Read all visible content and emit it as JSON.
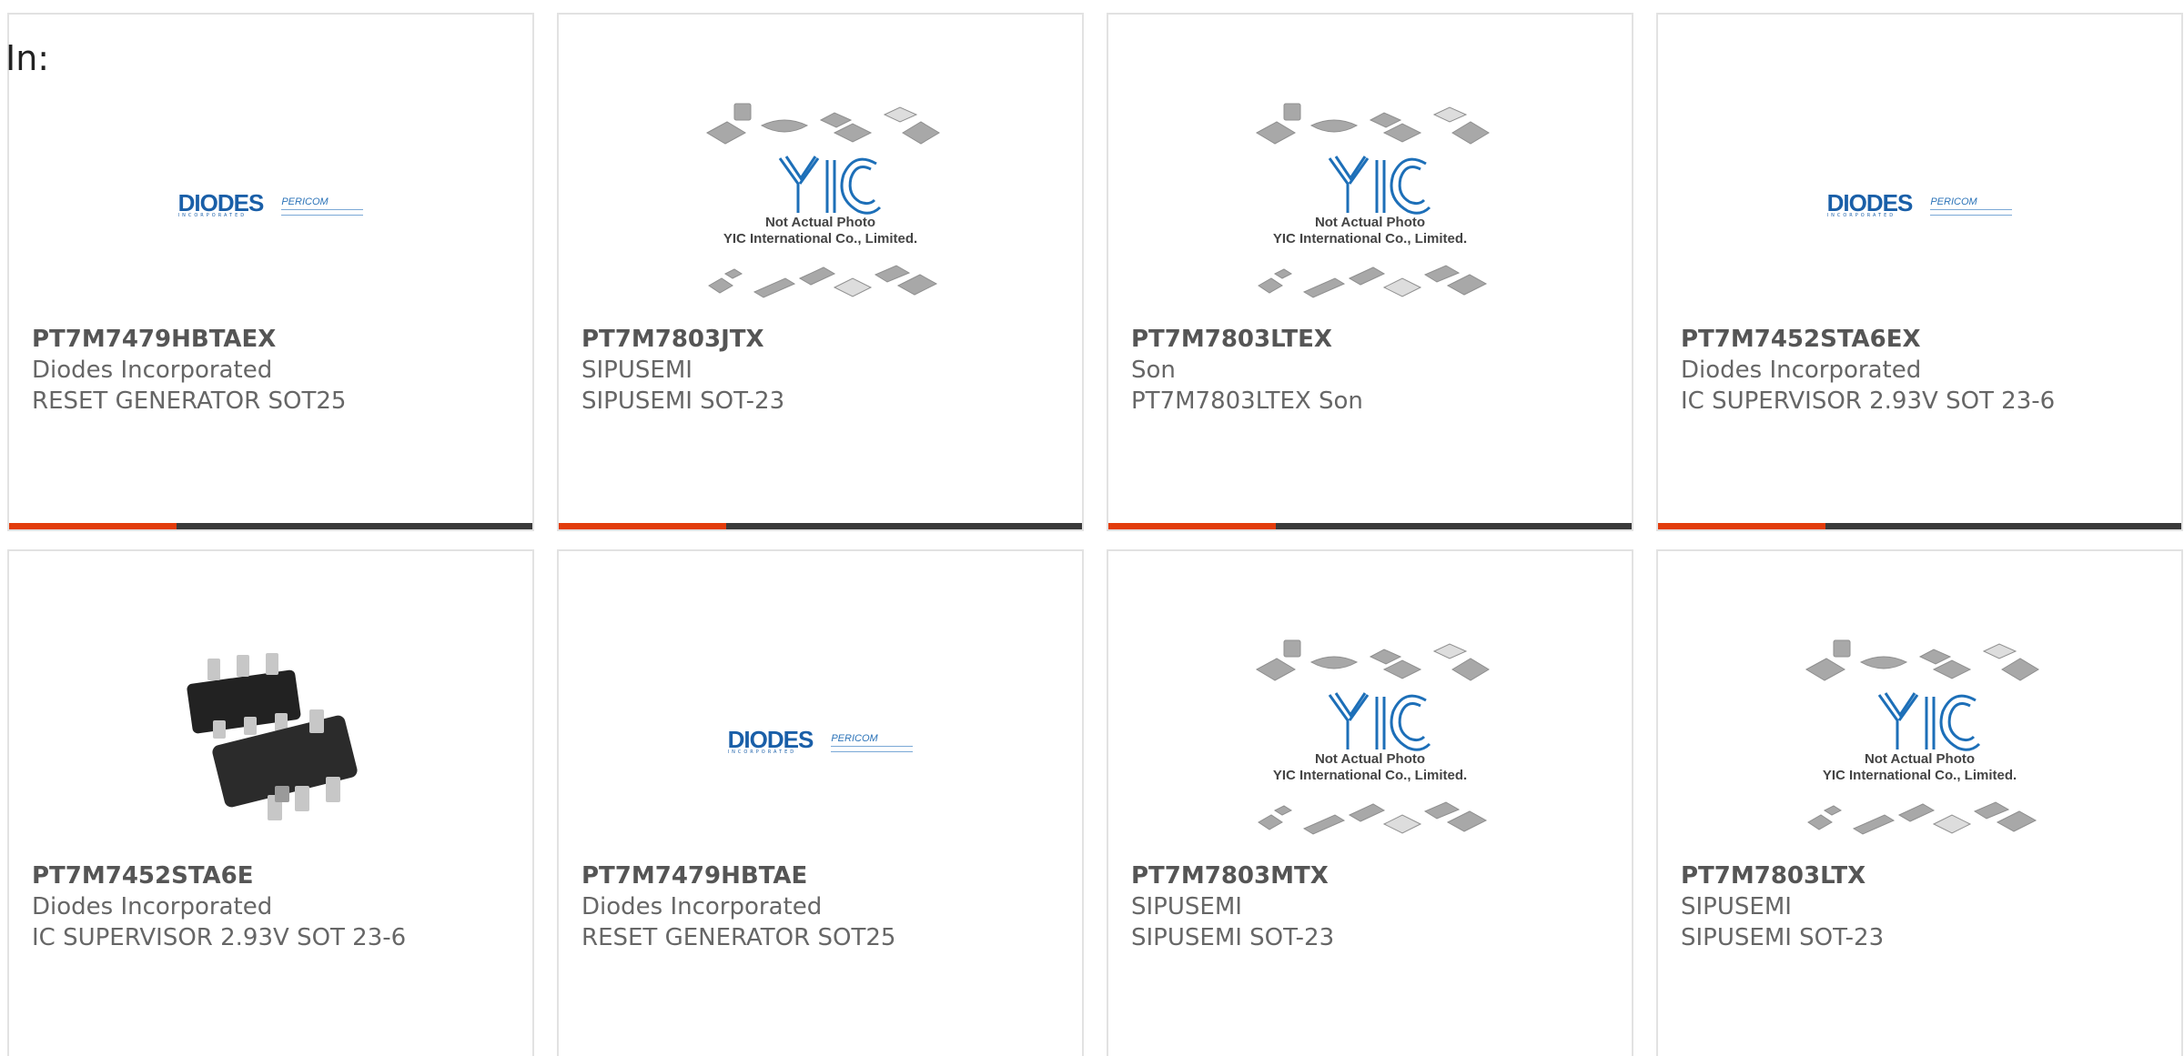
{
  "label": "In:",
  "colors": {
    "accent": "#e23c0c",
    "bar": "#3a3a3a",
    "border": "#e2e2e2"
  },
  "products": [
    {
      "part_number": "PT7M7479HBTAEX",
      "manufacturer": "Diodes Incorporated",
      "description": "RESET GENERATOR SOT25",
      "image": "diodes-logo",
      "logo_text": "DIODES",
      "logo_sub": "INCORPORATED",
      "logo_text2": "PERICOM"
    },
    {
      "part_number": "PT7M7803JTX",
      "manufacturer": "SIPUSEMI",
      "description": "SIPUSEMI SOT-23",
      "image": "yic-placeholder",
      "caption1": "Not Actual Photo",
      "caption2": "YIC International Co., Limited."
    },
    {
      "part_number": "PT7M7803LTEX",
      "manufacturer": "Son",
      "description": "PT7M7803LTEX Son",
      "image": "yic-placeholder",
      "caption1": "Not Actual Photo",
      "caption2": "YIC International Co., Limited."
    },
    {
      "part_number": "PT7M7452STA6EX",
      "manufacturer": "Diodes Incorporated",
      "description": "IC SUPERVISOR 2.93V SOT 23-6",
      "image": "diodes-logo",
      "logo_text": "DIODES",
      "logo_sub": "INCORPORATED",
      "logo_text2": "PERICOM"
    },
    {
      "part_number": "PT7M7452STA6E",
      "manufacturer": "Diodes Incorporated",
      "description": "IC SUPERVISOR 2.93V SOT 23-6",
      "image": "sot23-6-chip"
    },
    {
      "part_number": "PT7M7479HBTAE",
      "manufacturer": "Diodes Incorporated",
      "description": "RESET GENERATOR SOT25",
      "image": "diodes-logo",
      "logo_text": "DIODES",
      "logo_sub": "INCORPORATED",
      "logo_text2": "PERICOM"
    },
    {
      "part_number": "PT7M7803MTX",
      "manufacturer": "SIPUSEMI",
      "description": "SIPUSEMI SOT-23",
      "image": "yic-placeholder",
      "caption1": "Not Actual Photo",
      "caption2": "YIC International Co., Limited."
    },
    {
      "part_number": "PT7M7803LTX",
      "manufacturer": "SIPUSEMI",
      "description": "SIPUSEMI SOT-23",
      "image": "yic-placeholder",
      "caption1": "Not Actual Photo",
      "caption2": "YIC International Co., Limited."
    }
  ]
}
